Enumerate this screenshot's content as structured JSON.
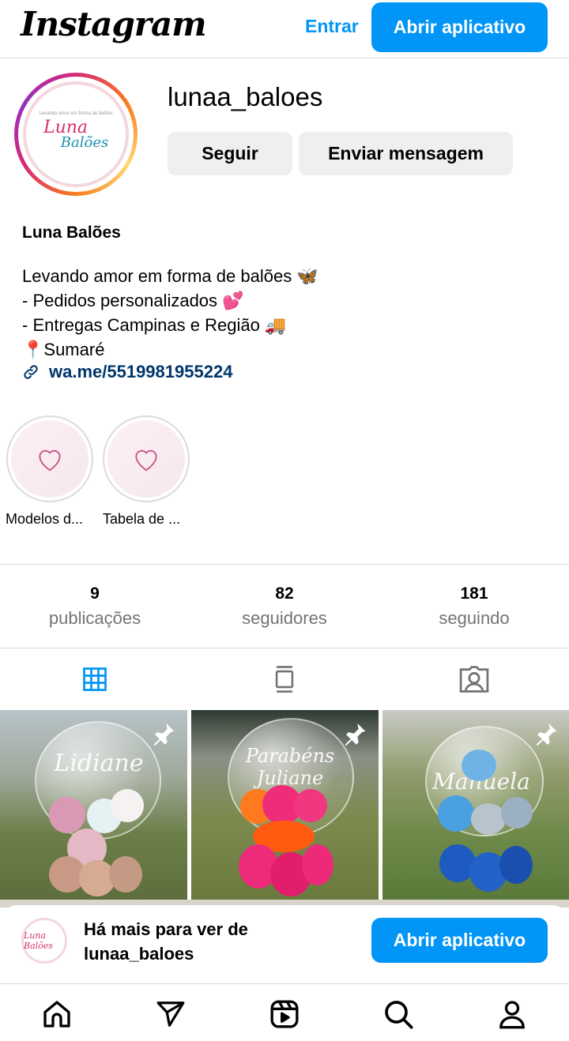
{
  "header": {
    "logo": "Instagram",
    "login_label": "Entrar",
    "open_app_label": "Abrir aplicativo"
  },
  "profile": {
    "username": "lunaa_baloes",
    "follow_label": "Seguir",
    "message_label": "Enviar mensagem",
    "full_name": "Luna Balões",
    "bio": [
      "Levando amor em forma de balões 🦋",
      "- Pedidos personalizados 💕",
      "- Entregas Campinas e Região 🚚",
      "📍Sumaré"
    ],
    "link": "wa.me/5519981955224",
    "avatar_text": {
      "top": "Levando amor em forma de balões",
      "line1": "Luna",
      "line2": "Balões"
    }
  },
  "highlights": [
    {
      "label": "Modelos d..."
    },
    {
      "label": "Tabela de ..."
    }
  ],
  "stats": {
    "posts": {
      "count": "9",
      "label": "publicações"
    },
    "followers": {
      "count": "82",
      "label": "seguidores"
    },
    "following": {
      "count": "181",
      "label": "seguindo"
    }
  },
  "tabs": [
    {
      "icon": "grid-icon",
      "active": true
    },
    {
      "icon": "feed-icon",
      "active": false
    },
    {
      "icon": "tagged-icon",
      "active": false
    }
  ],
  "posts": [
    {
      "caption": "Lidiane",
      "pinned": true
    },
    {
      "caption": "Parabéns Juliane",
      "pinned": true
    },
    {
      "caption": "Manuela",
      "pinned": true
    }
  ],
  "banner": {
    "avatar_text": "Luna Balões",
    "text_line1": "Há mais para ver de",
    "text_line2": "lunaa_baloes",
    "open_app_label": "Abrir aplicativo"
  },
  "nav": [
    {
      "icon": "home-icon"
    },
    {
      "icon": "direct-icon"
    },
    {
      "icon": "reels-icon"
    },
    {
      "icon": "search-icon"
    },
    {
      "icon": "profile-icon"
    }
  ],
  "colors": {
    "accent": "#0095f6",
    "link": "#00376b",
    "secondary_text": "#737373"
  }
}
